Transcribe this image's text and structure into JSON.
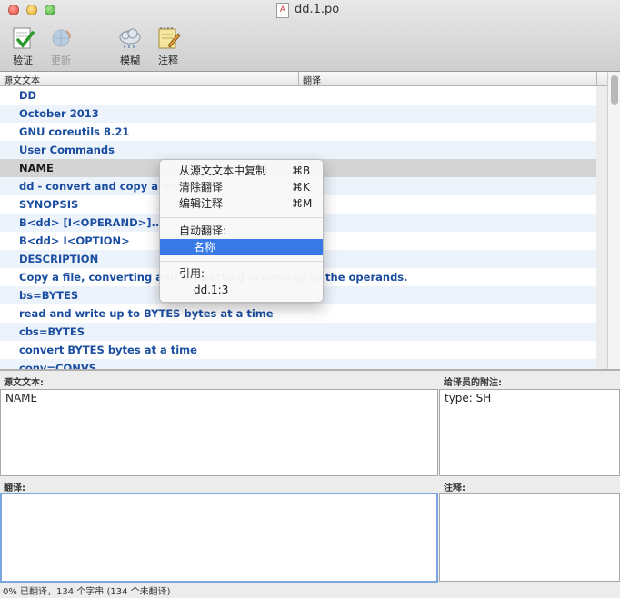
{
  "window": {
    "title": "dd.1.po"
  },
  "toolbar": {
    "validate": "验证",
    "update": "更新",
    "fuzzy": "模糊",
    "comment": "注释"
  },
  "list_header": {
    "source": "源文文本",
    "translation": "翻译"
  },
  "entries": [
    "DD",
    "October 2013",
    "GNU coreutils 8.21",
    "User Commands",
    "NAME",
    "dd - convert and copy a file",
    "SYNOPSIS",
    "B<dd> [I<OPERAND>]...",
    "B<dd> I<OPTION>",
    "DESCRIPTION",
    "Copy a file, converting and formatting according to the operands.",
    "bs=BYTES",
    "read and write up to BYTES bytes at a time",
    "cbs=BYTES",
    "convert BYTES bytes at a time",
    "conv=CONVS"
  ],
  "selected_entry": "NAME",
  "source_panel": {
    "label": "源文文本:",
    "text": "NAME"
  },
  "notes_panel": {
    "label": "给译员的附注:",
    "text": "type: SH"
  },
  "translation_panel": {
    "label": "翻译:",
    "text": ""
  },
  "comment_panel": {
    "label": "注释:",
    "text": ""
  },
  "status_bar": "0% 已翻译，134 个字串 (134 个未翻译)",
  "context_menu": {
    "copy_from_source": "从源文文本中复制",
    "copy_shortcut": "⌘B",
    "clear_translation": "清除翻译",
    "clear_shortcut": "⌘K",
    "edit_comment": "编辑注释",
    "edit_shortcut": "⌘M",
    "auto_translate_label": "自动翻译:",
    "auto_translate_suggestion": "名称",
    "references_label": "引用:",
    "reference": "dd.1:3"
  }
}
